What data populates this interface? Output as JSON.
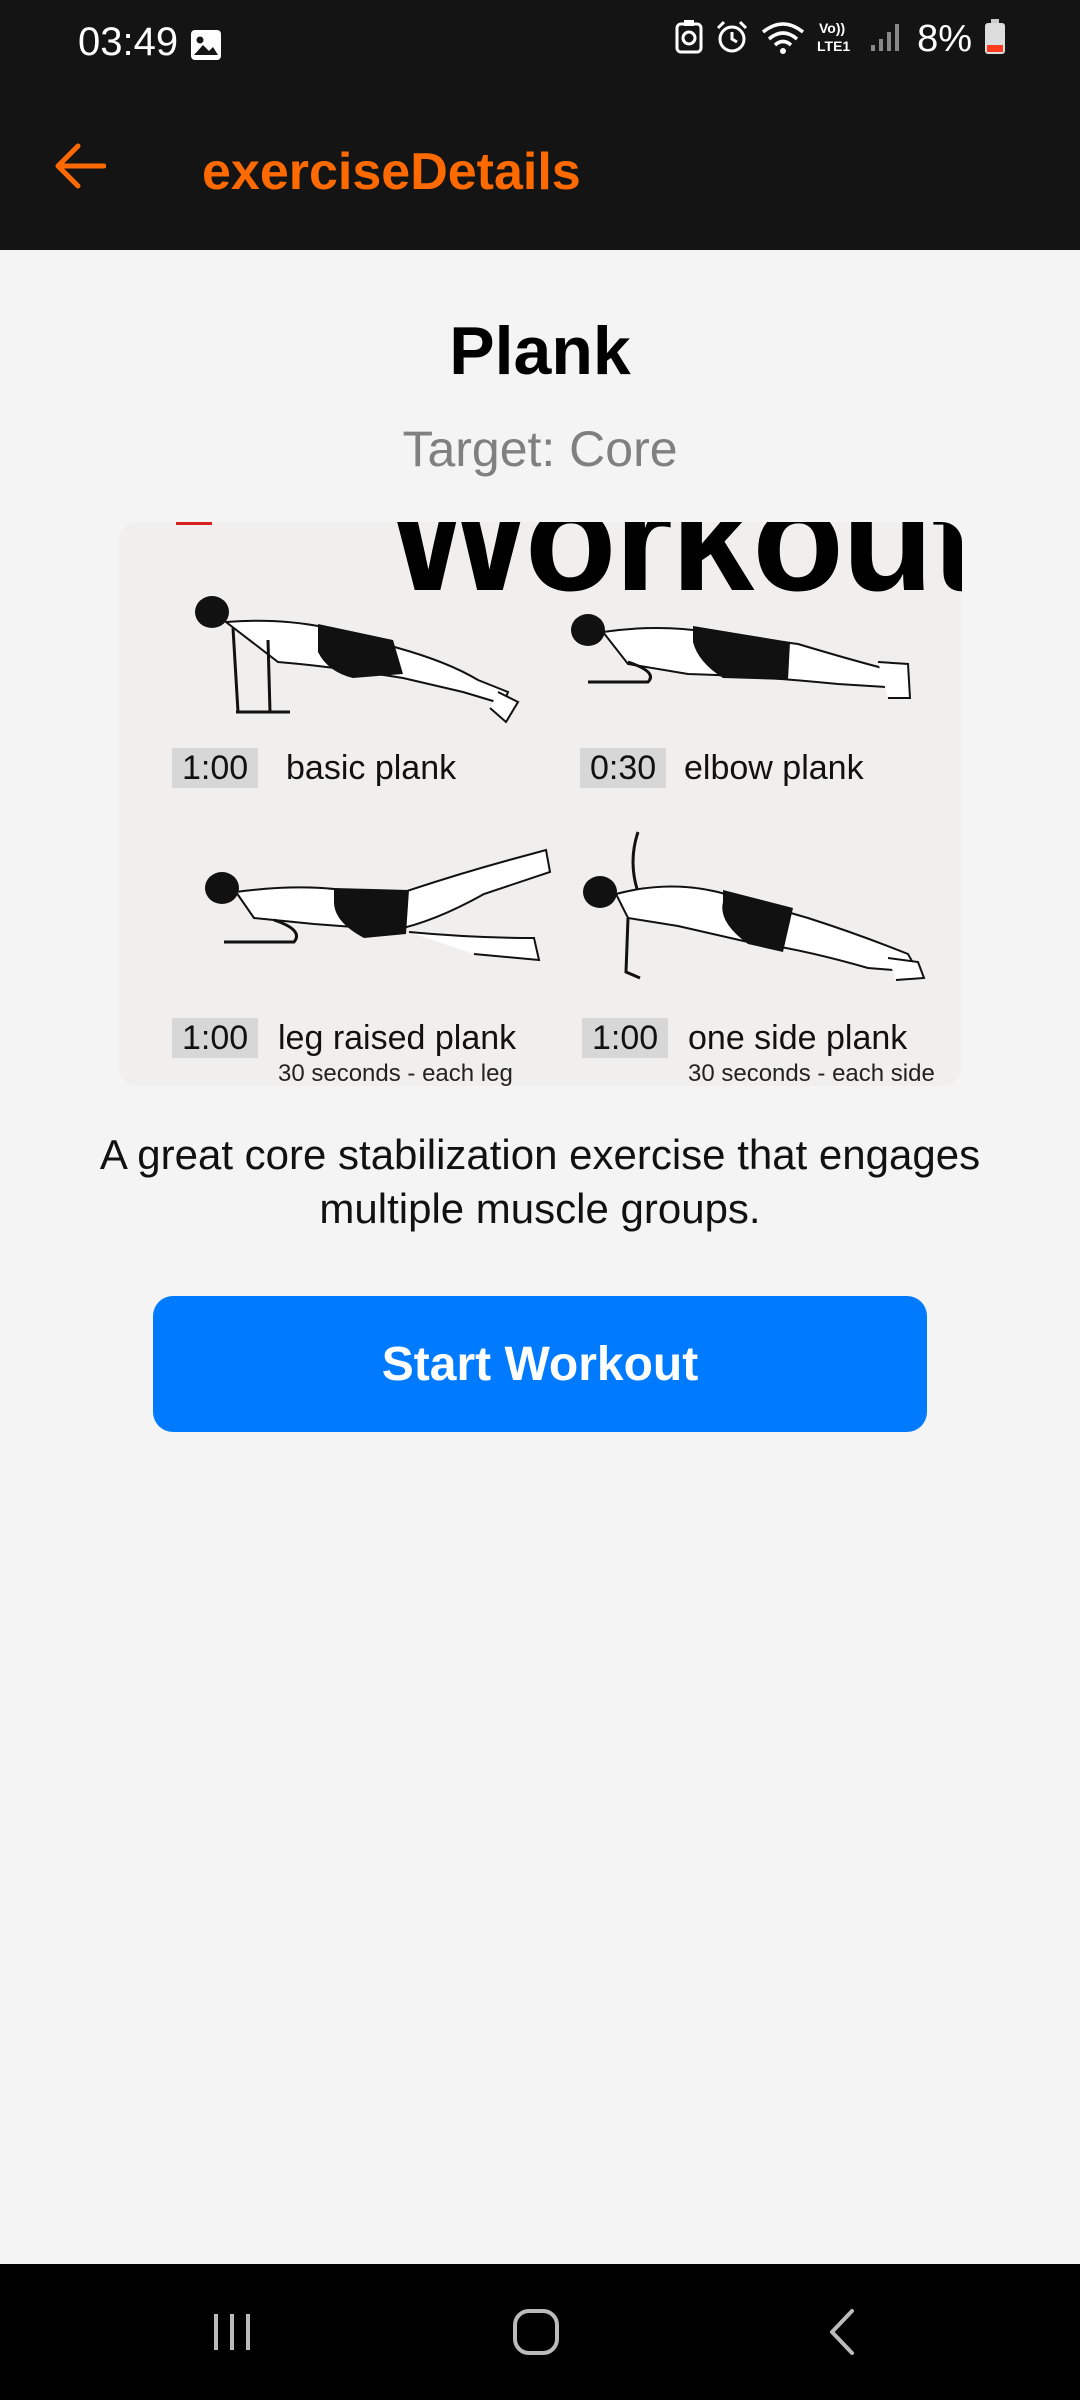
{
  "status_bar": {
    "time": "03:49",
    "battery": "8%",
    "icons": [
      "gallery-icon",
      "recycle-icon",
      "alarm-icon",
      "wifi-icon",
      "volte-lte-icon",
      "signal-icon",
      "battery-icon"
    ]
  },
  "app_bar": {
    "title": "exerciseDetails",
    "back_icon": "arrow-left-icon",
    "accent_color": "#ff6a00"
  },
  "exercise": {
    "name": "Plank",
    "target": "Target: Core",
    "description": "A great core stabilization exercise that engages multiple muscle groups."
  },
  "illustration": {
    "heading": "Workout",
    "items": [
      {
        "time": "1:00",
        "label": "basic plank",
        "sub": ""
      },
      {
        "time": "0:30",
        "label": "elbow plank",
        "sub": ""
      },
      {
        "time": "1:00",
        "label": "leg raised plank",
        "sub": "30 seconds - each leg"
      },
      {
        "time": "1:00",
        "label": "one side plank",
        "sub": "30 seconds - each side"
      }
    ]
  },
  "actions": {
    "start_label": "Start Workout",
    "button_color": "#007bff"
  },
  "nav_bar": {
    "icons": [
      "recent-apps-icon",
      "home-icon",
      "back-icon"
    ]
  }
}
